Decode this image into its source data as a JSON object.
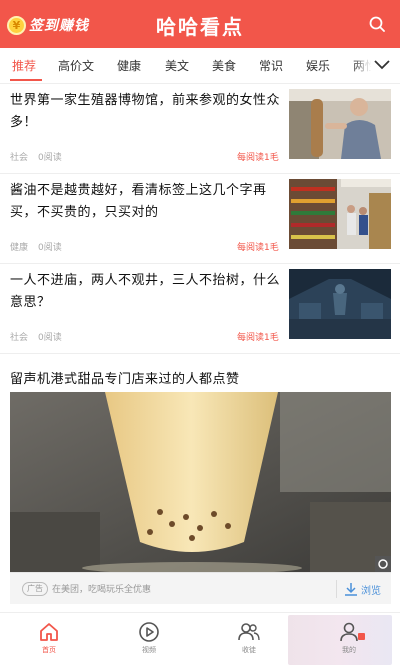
{
  "header": {
    "sign_label": "签到赚钱",
    "coin_symbol": "¥",
    "title": "哈哈看点",
    "icons": [
      "coin-icon",
      "search-icon"
    ]
  },
  "tabs": [
    {
      "label": "推荐",
      "active": true
    },
    {
      "label": "高价文",
      "active": false
    },
    {
      "label": "健康",
      "active": false
    },
    {
      "label": "美文",
      "active": false
    },
    {
      "label": "美食",
      "active": false
    },
    {
      "label": "常识",
      "active": false
    },
    {
      "label": "娱乐",
      "active": false
    },
    {
      "label": "两性",
      "active": false
    }
  ],
  "news": [
    {
      "title": "世界第一家生殖器博物馆，前来参观的女性众多！",
      "category": "社会",
      "reads": "0阅读",
      "reward": "每阅读1毛"
    },
    {
      "title": "酱油不是越贵越好，看清标签上这几个字再买，不买贵的，只买对的",
      "category": "健康",
      "reads": "0阅读",
      "reward": "每阅读1毛"
    },
    {
      "title": "一人不进庙，两人不观井，三人不抬树，什么意思？",
      "category": "社会",
      "reads": "0阅读",
      "reward": "每阅读1毛"
    }
  ],
  "ad": {
    "title": "留声机港式甜品专门店来过的人都点赞",
    "tag": "广告",
    "desc": "在美团，吃喝玩乐全优惠",
    "browse_label": "浏览"
  },
  "bottom_nav": [
    {
      "label": "首页",
      "icon": "home-icon",
      "active": true
    },
    {
      "label": "视频",
      "icon": "play-icon",
      "active": false
    },
    {
      "label": "收徒",
      "icon": "users-icon",
      "active": false
    },
    {
      "label": "我的",
      "icon": "profile-icon",
      "active": false
    }
  ],
  "colors": {
    "accent": "#f2564a",
    "link": "#4a90d9"
  }
}
